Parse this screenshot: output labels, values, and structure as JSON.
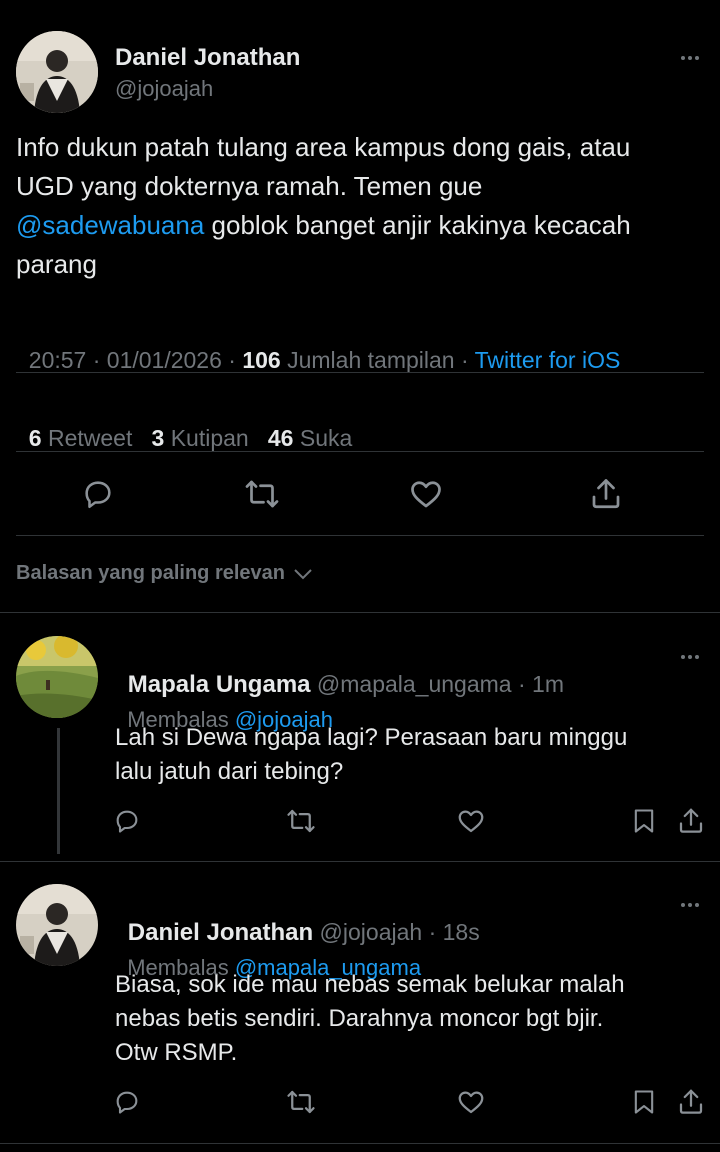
{
  "main_tweet": {
    "author_name": "Daniel Jonathan",
    "author_handle": "@jojoajah",
    "text_line1": "Info dukun patah tulang area kampus dong gais, atau",
    "text_line2": "UGD yang dokternya ramah. Temen gue",
    "mention": "@sadewabuana",
    "text_line3_rest": " goblok banget anjir kakinya kecacah",
    "text_line4": "parang",
    "time_date": "20:57 · 01/01/2026 · ",
    "views_count": "106",
    "views_label": " Jumlah tampilan · ",
    "source": "Twitter for iOS",
    "retweet_count": "6",
    "retweet_label": "Retweet",
    "quote_count": "3",
    "quote_label": "Kutipan",
    "like_count": "46",
    "like_label": "Suka"
  },
  "sort_label": "Balasan yang paling relevan",
  "replies": [
    {
      "name": "Mapala Ungama",
      "handle_time": "@mapala_ungama · 1m",
      "replying_prefix": "Membalas ",
      "replying_to": "@jojoajah",
      "line1": "Lah si Dewa ngapa lagi? Perasaan baru minggu",
      "line2": "lalu jatuh dari tebing?"
    },
    {
      "name": "Daniel Jonathan",
      "handle_time": "@jojoajah · 18s",
      "replying_prefix": "Membalas ",
      "replying_to": "@mapala_ungama",
      "line1": "Biasa, sok ide mau nebas semak belukar malah",
      "line2": "nebas betis sendiri. Darahnya moncor bgt bjir.",
      "line3": "Otw RSMP."
    }
  ],
  "colors": {
    "background": "#000000",
    "text": "#e7e9ea",
    "muted": "#71767b",
    "link": "#1d9bf0",
    "divider": "#2f3336"
  }
}
